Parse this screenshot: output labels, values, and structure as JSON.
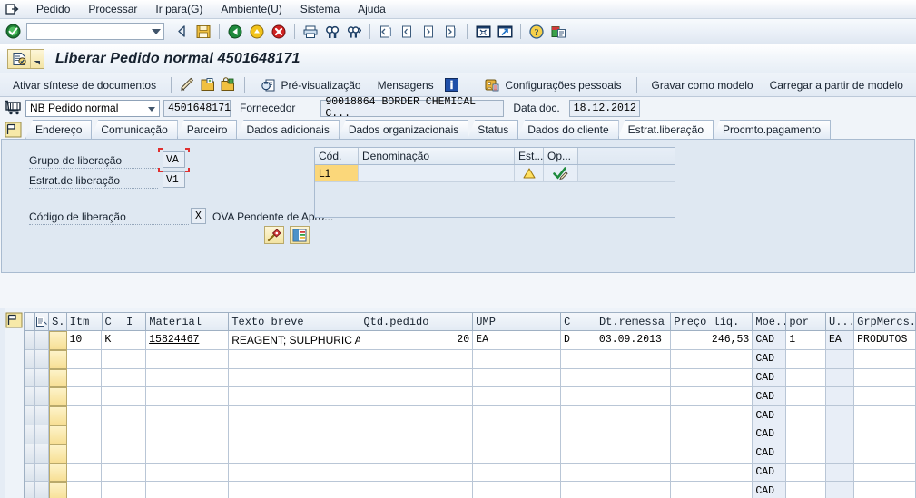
{
  "menubar": {
    "sys_icon": "system-menu-icon",
    "items": [
      {
        "label": "Pedido",
        "accel": "P"
      },
      {
        "label": "Processar",
        "accel": "e"
      },
      {
        "label": "Ir para(G)",
        "accel": "G"
      },
      {
        "label": "Ambiente(U)",
        "accel": "U"
      },
      {
        "label": "Sistema",
        "accel": "S"
      },
      {
        "label": "Ajuda",
        "accel": "A"
      }
    ]
  },
  "toolbar": {
    "ok_icon": "enter-check-icon",
    "command_value": "",
    "command_placeholder": "",
    "buttons": [
      {
        "name": "back-icon"
      },
      {
        "name": "save-icon"
      },
      {
        "name": "exit-green-icon"
      },
      {
        "name": "cancel-yellow-icon"
      },
      {
        "name": "stop-red-icon"
      },
      {
        "name": "print-icon"
      },
      {
        "name": "find-icon"
      },
      {
        "name": "find-next-icon"
      },
      {
        "name": "first-page-icon"
      },
      {
        "name": "previous-page-icon"
      },
      {
        "name": "next-page-icon"
      },
      {
        "name": "last-page-icon"
      },
      {
        "name": "new-session-icon"
      },
      {
        "name": "create-shortcut-icon"
      },
      {
        "name": "help-icon"
      },
      {
        "name": "customize-layout-icon"
      }
    ]
  },
  "title": {
    "icon": "release-document-icon",
    "dropdown_icon": "chevron-down-icon",
    "text": "Liberar Pedido normal 4501648171"
  },
  "apptoolbar": {
    "document_overview": "Ativar síntese de documentos",
    "icons": [
      {
        "name": "pencil-display-change-icon"
      },
      {
        "name": "other-document-icon"
      },
      {
        "name": "hold-document-icon"
      }
    ],
    "preview": "Pré-visualização",
    "preview_icon": "print-preview-icon",
    "messages": "Mensagens",
    "messages_icon": "info-blue-icon",
    "personal_settings": "Configurações pessoais",
    "personal_settings_icon": "personal-settings-icon",
    "save_as_template": "Gravar como modelo",
    "load_from_template": "Carregar a partir de modelo"
  },
  "header": {
    "cart_icon": "purchase-order-cart-icon",
    "doc_type": "NB Pedido normal",
    "doc_number": "4501648171",
    "vendor_label": "Fornecedor",
    "vendor_value": "90018864 BORDER CHEMICAL C...",
    "doc_date_label": "Data doc.",
    "doc_date_value": "18.12.2012"
  },
  "tabs": {
    "flag_icon": "header-detail-flag-icon",
    "items": [
      {
        "label": "Endereço",
        "active": false
      },
      {
        "label": "Comunicação",
        "active": false
      },
      {
        "label": "Parceiro",
        "active": false
      },
      {
        "label": "Dados adicionais",
        "active": false
      },
      {
        "label": "Dados organizacionais",
        "active": false
      },
      {
        "label": "Status",
        "active": false
      },
      {
        "label": "Dados do cliente",
        "active": false
      },
      {
        "label": "Estrat.liberação",
        "active": true
      },
      {
        "label": "Procmto.pagamento",
        "active": false
      }
    ]
  },
  "release": {
    "group_label": "Grupo de liberação",
    "group_value": "VA",
    "group_focused": true,
    "strategy_label": "Estrat.de liberação",
    "strategy_value": "V1",
    "code_label": "Código de liberação",
    "code_value": "X",
    "code_desc": "OVA Pendente de Apro...",
    "buttons": [
      {
        "name": "release-hammer-icon"
      },
      {
        "name": "release-prerequisites-icon"
      }
    ],
    "grid": {
      "columns": [
        "Cód.",
        "Denominação",
        "Est...",
        "Op..."
      ],
      "rows": [
        {
          "code": "L1",
          "denomination": "",
          "status_icon": "warning-triangle-icon",
          "operation_icon": "green-check-pencil-icon"
        }
      ]
    }
  },
  "items": {
    "flag_icon": "item-detail-flag-icon",
    "columns": [
      {
        "key": "rowsel",
        "label": "",
        "width": 12
      },
      {
        "key": "layout",
        "label": "",
        "width": 16
      },
      {
        "key": "status",
        "label": "S..",
        "width": 20
      },
      {
        "key": "itm",
        "label": "Itm",
        "width": 40
      },
      {
        "key": "c1",
        "label": "C",
        "width": 24
      },
      {
        "key": "i",
        "label": "I",
        "width": 26
      },
      {
        "key": "material",
        "label": "Material",
        "width": 94
      },
      {
        "key": "texto",
        "label": "Texto breve",
        "width": 150
      },
      {
        "key": "qtd",
        "label": "Qtd.pedido",
        "width": 128
      },
      {
        "key": "ump",
        "label": "UMP",
        "width": 100
      },
      {
        "key": "c2",
        "label": "C",
        "width": 40
      },
      {
        "key": "dtrem",
        "label": "Dt.remessa",
        "width": 85
      },
      {
        "key": "preco",
        "label": "Preço líq.",
        "width": 93
      },
      {
        "key": "moe",
        "label": "Moe...",
        "width": 38
      },
      {
        "key": "por",
        "label": "por",
        "width": 45
      },
      {
        "key": "u",
        "label": "U...",
        "width": 32
      },
      {
        "key": "grpmercs",
        "label": "GrpMercs.",
        "width": 70
      }
    ],
    "rows": [
      {
        "status": "",
        "itm": "10",
        "c1": "K",
        "i": "",
        "material": "15824467",
        "material_link": true,
        "texto": "REAGENT; SULPHURIC A...",
        "qtd": "20",
        "ump": "EA",
        "c2": "D",
        "dtrem": "03.09.2013",
        "preco": "246,53",
        "moe": "CAD",
        "por": "1",
        "u": "EA",
        "grpmercs": "PRODUTOS"
      },
      {
        "moe": "CAD"
      },
      {
        "moe": "CAD"
      },
      {
        "moe": "CAD"
      },
      {
        "moe": "CAD"
      },
      {
        "moe": "CAD"
      },
      {
        "moe": "CAD"
      },
      {
        "moe": "CAD"
      },
      {
        "moe": "CAD"
      }
    ]
  },
  "colors": {
    "accent": "#dfe8f2",
    "selected_cell": "#fbd77a",
    "focus_outline": "#e03030",
    "grid_header": "#e3ebf4",
    "window_bg": "#f3f6fa"
  }
}
